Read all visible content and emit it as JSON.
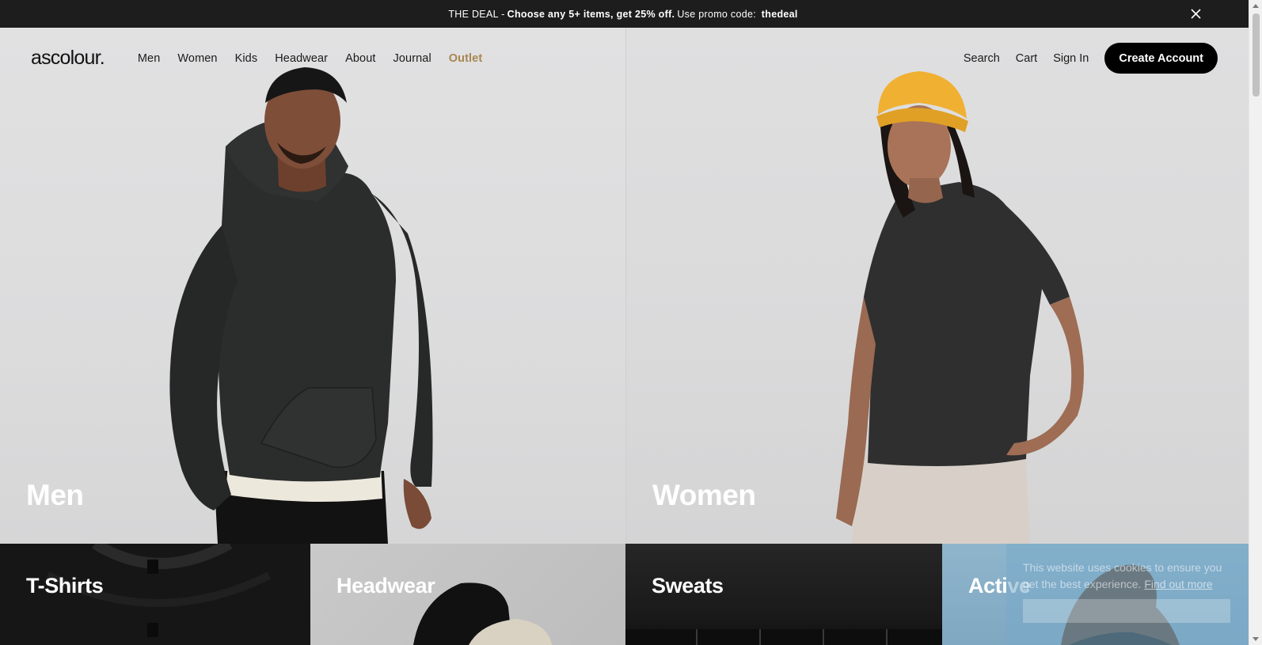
{
  "announcement": {
    "prefix": "THE DEAL -",
    "offer": "Choose any 5+ items, get 25% off.",
    "promo_text": "Use promo code:",
    "code": "thedeal",
    "close_icon": "close-icon"
  },
  "header": {
    "logo": "ascolour.",
    "nav": [
      "Men",
      "Women",
      "Kids",
      "Headwear",
      "About",
      "Journal",
      "Outlet"
    ],
    "search": "Search",
    "cart": "Cart",
    "sign_in": "Sign In",
    "create_account": "Create Account"
  },
  "hero": {
    "men_label": "Men",
    "women_label": "Women"
  },
  "categories": [
    "T-Shirts",
    "Headwear",
    "Sweats",
    "Active"
  ],
  "cookie": {
    "text": "This website uses cookies to ensure you get the best experience.",
    "link": "Find out more"
  },
  "colors": {
    "outlet": "#a8864f",
    "announcement_bg": "#1d1d1d",
    "button_bg": "#000000"
  }
}
